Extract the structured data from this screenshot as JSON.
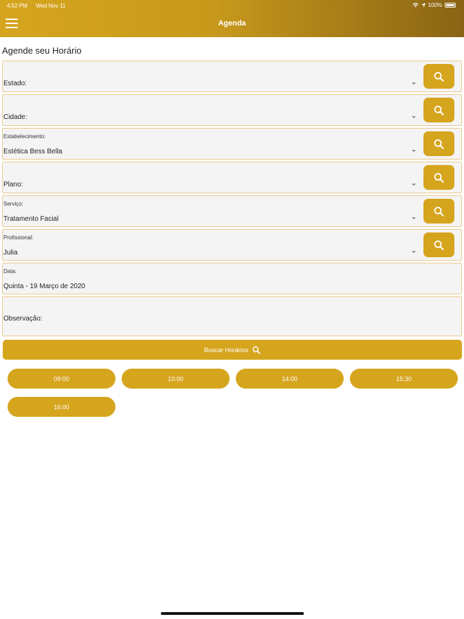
{
  "status_bar": {
    "time": "4:52 PM",
    "date": "Wed Nov 11",
    "battery": "100%"
  },
  "nav": {
    "title": "Agenda",
    "menu_icon": "hamburger-menu-icon"
  },
  "section_title": "Agende seu Horário",
  "fields": [
    {
      "label": "Estado:",
      "value": "",
      "icon": "search-icon"
    },
    {
      "label": "Cidade:",
      "value": "",
      "icon": "search-icon"
    },
    {
      "label": "Estabelecimento:",
      "value": "Estética Bess Bella",
      "icon": "search-icon"
    },
    {
      "label": "Plano:",
      "value": "",
      "icon": "search-icon"
    },
    {
      "label": "Serviço:",
      "value": "Tratamento Facial",
      "icon": "search-icon"
    },
    {
      "label": "Profissional:",
      "value": "Julia",
      "icon": "search-icon"
    }
  ],
  "date_field": {
    "label": "Data:",
    "value": "Quinta - 19 Março de 2020"
  },
  "observation_field": {
    "label": "Observação:"
  },
  "search_button": {
    "label": "Buscar Horários",
    "icon": "search-icon"
  },
  "time_slots": [
    "09:00",
    "10:00",
    "14:00",
    "15:30",
    "16:00"
  ],
  "colors": {
    "accent": "#d6a51e",
    "header_dark": "#8a6414",
    "field_border": "#ecc98f",
    "field_bg": "#f4f4f4"
  }
}
